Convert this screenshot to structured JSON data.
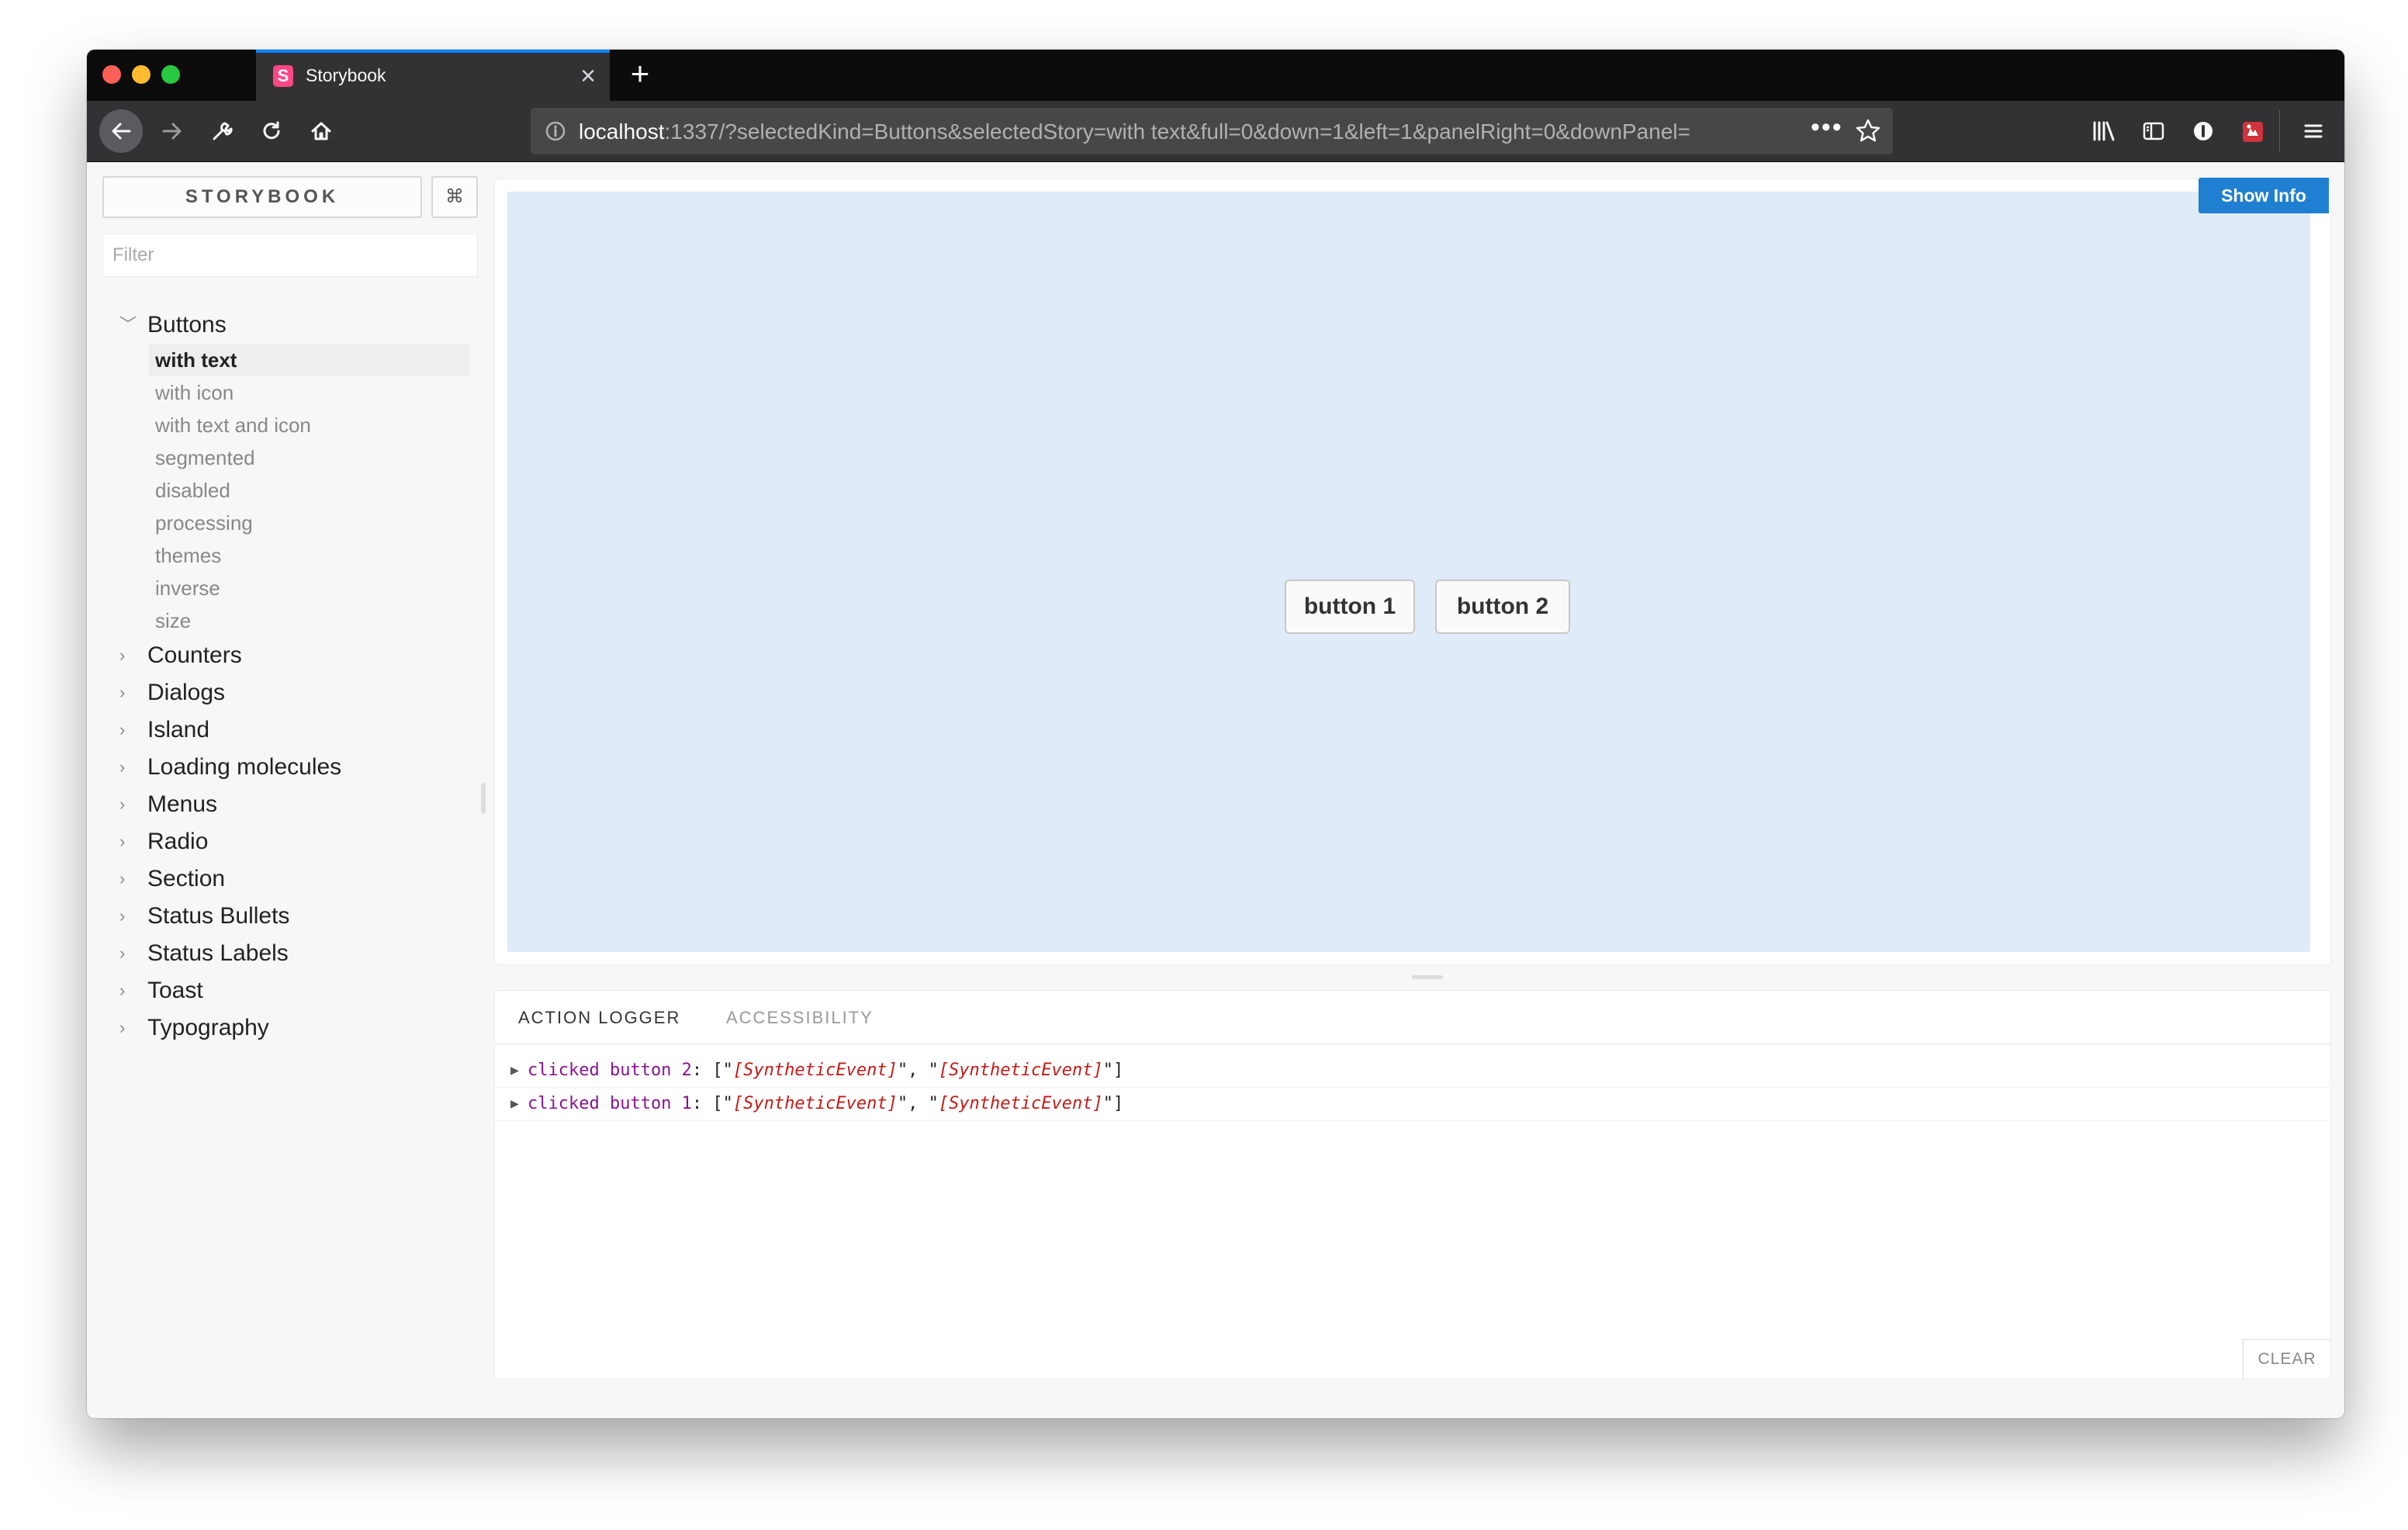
{
  "browser": {
    "tab_title": "Storybook",
    "tab_favicon_letter": "S",
    "url_host": "localhost",
    "url_rest": ":1337/?selectedKind=Buttons&selectedStory=with text&full=0&down=1&left=1&panelRight=0&downPanel=",
    "url_dots": "•••",
    "accent_color": "#0a84ff",
    "icons": [
      "back-icon",
      "forward-icon",
      "wrench-icon",
      "reload-icon",
      "home-icon",
      "info-icon",
      "bookmark-star-icon",
      "library-icon",
      "sidebar-icon",
      "extension-icon",
      "addon-icon",
      "menu-icon",
      "close-icon",
      "plus-icon"
    ]
  },
  "sidebar": {
    "title": "STORYBOOK",
    "shortcut": "⌘",
    "filter_placeholder": "Filter",
    "kinds": [
      {
        "label": "Buttons",
        "expanded": true,
        "stories": [
          {
            "label": "with text",
            "selected": true
          },
          {
            "label": "with icon"
          },
          {
            "label": "with text and icon"
          },
          {
            "label": "segmented"
          },
          {
            "label": "disabled"
          },
          {
            "label": "processing"
          },
          {
            "label": "themes"
          },
          {
            "label": "inverse"
          },
          {
            "label": "size"
          }
        ]
      },
      {
        "label": "Counters"
      },
      {
        "label": "Dialogs"
      },
      {
        "label": "Island"
      },
      {
        "label": "Loading molecules"
      },
      {
        "label": "Menus"
      },
      {
        "label": "Radio"
      },
      {
        "label": "Section"
      },
      {
        "label": "Status Bullets"
      },
      {
        "label": "Status Labels"
      },
      {
        "label": "Toast"
      },
      {
        "label": "Typography"
      }
    ]
  },
  "preview": {
    "show_info_label": "Show Info",
    "show_info_color": "#1f7fd1",
    "background_color": "#e0ebf9",
    "buttons": [
      "button 1",
      "button 2"
    ]
  },
  "panel": {
    "tabs": [
      "ACTION LOGGER",
      "ACCESSIBILITY"
    ],
    "active_tab": "ACTION LOGGER",
    "log": [
      {
        "name": "clicked button 2",
        "args": [
          "[SyntheticEvent]",
          "[SyntheticEvent]"
        ]
      },
      {
        "name": "clicked button 1",
        "args": [
          "[SyntheticEvent]",
          "[SyntheticEvent]"
        ]
      }
    ],
    "clear_label": "CLEAR"
  }
}
